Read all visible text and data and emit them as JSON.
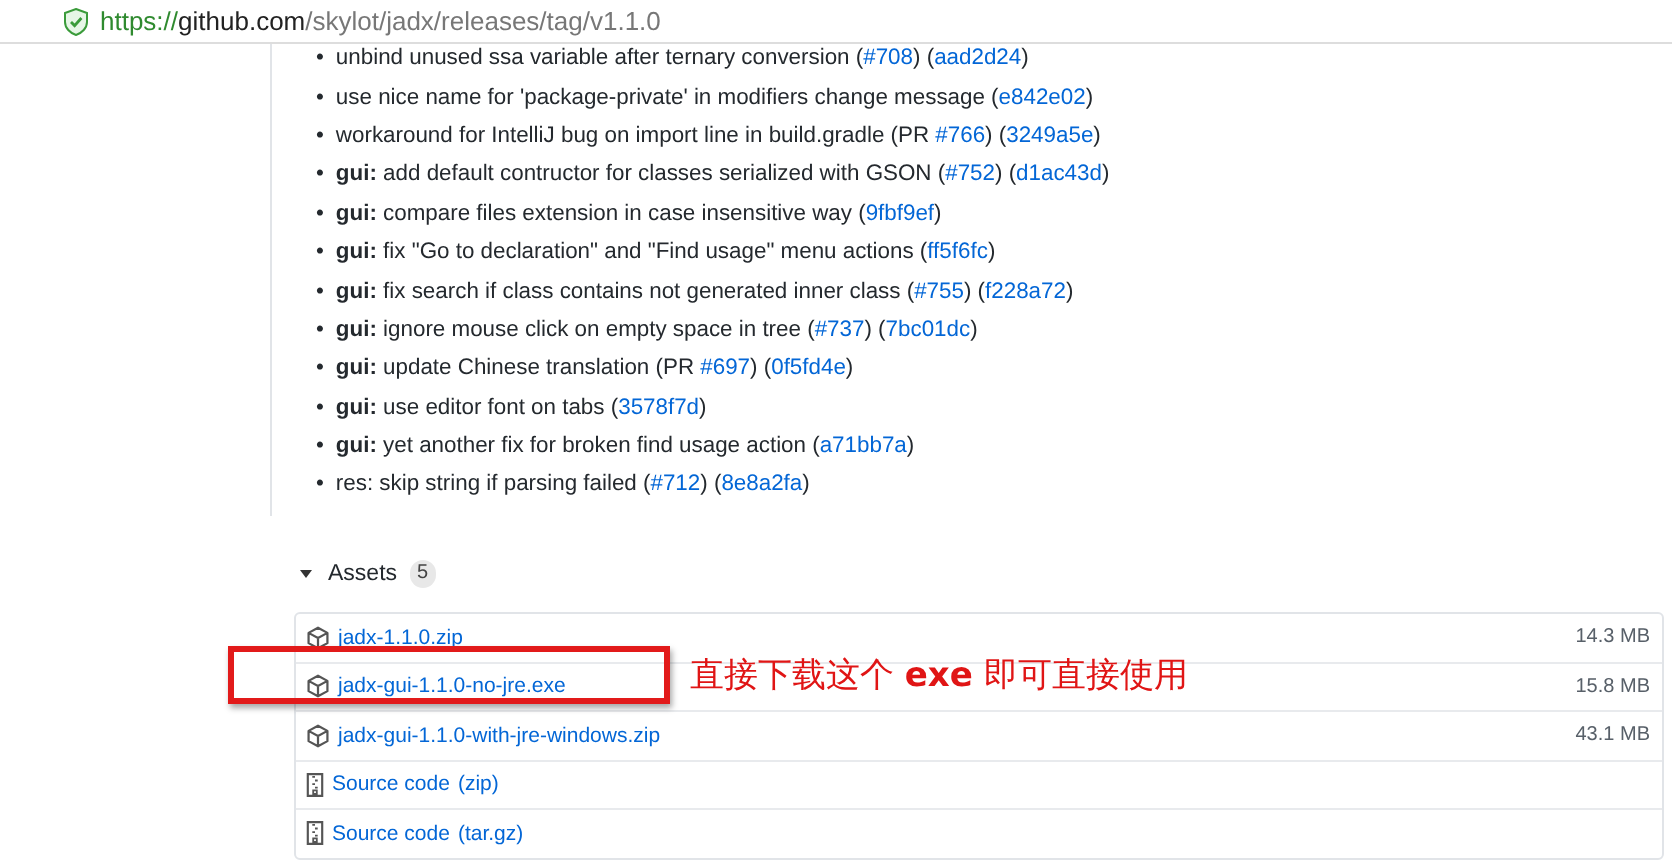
{
  "address_bar": {
    "scheme": "https://",
    "host": "github.com",
    "path": "/skylot/jadx/releases/tag/v1.1.0"
  },
  "release_notes": [
    {
      "marker": "•",
      "segments": [
        {
          "kind": "plain",
          "text": "unbind unused ssa variable after ternary conversion ("
        },
        {
          "kind": "link",
          "text": "#708"
        },
        {
          "kind": "plain",
          "text": ") ("
        },
        {
          "kind": "link",
          "text": "aad2d24"
        },
        {
          "kind": "plain",
          "text": ")"
        }
      ]
    },
    {
      "marker": "•",
      "segments": [
        {
          "kind": "plain",
          "text": "use nice name for 'package-private' in modifiers change message ("
        },
        {
          "kind": "link",
          "text": "e842e02"
        },
        {
          "kind": "plain",
          "text": ")"
        }
      ]
    },
    {
      "marker": "•",
      "segments": [
        {
          "kind": "plain",
          "text": "workaround for IntelliJ bug on import line in build.gradle (PR "
        },
        {
          "kind": "link",
          "text": "#766"
        },
        {
          "kind": "plain",
          "text": ") ("
        },
        {
          "kind": "link",
          "text": "3249a5e"
        },
        {
          "kind": "plain",
          "text": ")"
        }
      ]
    },
    {
      "marker": "•",
      "segments": [
        {
          "kind": "bold",
          "text": "gui:"
        },
        {
          "kind": "plain",
          "text": " add default contructor for classes serialized with GSON ("
        },
        {
          "kind": "link",
          "text": "#752"
        },
        {
          "kind": "plain",
          "text": ") ("
        },
        {
          "kind": "link",
          "text": "d1ac43d"
        },
        {
          "kind": "plain",
          "text": ")"
        }
      ]
    },
    {
      "marker": "•",
      "segments": [
        {
          "kind": "bold",
          "text": "gui:"
        },
        {
          "kind": "plain",
          "text": " compare files extension in case insensitive way ("
        },
        {
          "kind": "link",
          "text": "9fbf9ef"
        },
        {
          "kind": "plain",
          "text": ")"
        }
      ]
    },
    {
      "marker": "•",
      "segments": [
        {
          "kind": "bold",
          "text": "gui:"
        },
        {
          "kind": "plain",
          "text": " fix \"Go to declaration\" and \"Find usage\" menu actions ("
        },
        {
          "kind": "link",
          "text": "ff5f6fc"
        },
        {
          "kind": "plain",
          "text": ")"
        }
      ]
    },
    {
      "marker": "•",
      "segments": [
        {
          "kind": "bold",
          "text": "gui:"
        },
        {
          "kind": "plain",
          "text": " fix search if class contains not generated inner class ("
        },
        {
          "kind": "link",
          "text": "#755"
        },
        {
          "kind": "plain",
          "text": ") ("
        },
        {
          "kind": "link",
          "text": "f228a72"
        },
        {
          "kind": "plain",
          "text": ")"
        }
      ]
    },
    {
      "marker": "•",
      "segments": [
        {
          "kind": "bold",
          "text": "gui:"
        },
        {
          "kind": "plain",
          "text": " ignore mouse click on empty space in tree ("
        },
        {
          "kind": "link",
          "text": "#737"
        },
        {
          "kind": "plain",
          "text": ") ("
        },
        {
          "kind": "link",
          "text": "7bc01dc"
        },
        {
          "kind": "plain",
          "text": ")"
        }
      ]
    },
    {
      "marker": "•",
      "segments": [
        {
          "kind": "bold",
          "text": "gui:"
        },
        {
          "kind": "plain",
          "text": " update Chinese translation (PR "
        },
        {
          "kind": "link",
          "text": "#697"
        },
        {
          "kind": "plain",
          "text": ") ("
        },
        {
          "kind": "link",
          "text": "0f5fd4e"
        },
        {
          "kind": "plain",
          "text": ")"
        }
      ]
    },
    {
      "marker": "•",
      "segments": [
        {
          "kind": "bold",
          "text": "gui:"
        },
        {
          "kind": "plain",
          "text": " use editor font on tabs ("
        },
        {
          "kind": "link",
          "text": "3578f7d"
        },
        {
          "kind": "plain",
          "text": ")"
        }
      ]
    },
    {
      "marker": "•",
      "segments": [
        {
          "kind": "bold",
          "text": "gui:"
        },
        {
          "kind": "plain",
          "text": " yet another fix for broken find usage action ("
        },
        {
          "kind": "link",
          "text": "a71bb7a"
        },
        {
          "kind": "plain",
          "text": ")"
        }
      ]
    },
    {
      "marker": "•",
      "segments": [
        {
          "kind": "plain",
          "text": "res: skip string if parsing failed ("
        },
        {
          "kind": "link",
          "text": "#712"
        },
        {
          "kind": "plain",
          "text": ") ("
        },
        {
          "kind": "link",
          "text": "8e8a2fa"
        },
        {
          "kind": "plain",
          "text": ")"
        }
      ]
    }
  ],
  "assets": {
    "title": "Assets",
    "count": "5",
    "expanded": true,
    "items": [
      {
        "kind": "package",
        "name": "jadx-1.1.0.zip",
        "size": "14.3 MB"
      },
      {
        "kind": "package",
        "name": "jadx-gui-1.1.0-no-jre.exe",
        "size": "15.8 MB"
      },
      {
        "kind": "package",
        "name": "jadx-gui-1.1.0-with-jre-windows.zip",
        "size": "43.1 MB"
      },
      {
        "kind": "source",
        "name": "Source code",
        "format": "(zip)"
      },
      {
        "kind": "source",
        "name": "Source code",
        "format": "(tar.gz)"
      }
    ]
  },
  "annotation": {
    "segments": [
      {
        "kind": "plain",
        "text": "直接下载这个 "
      },
      {
        "kind": "bold",
        "text": "exe"
      },
      {
        "kind": "plain",
        "text": " 即可直接使用"
      }
    ]
  }
}
